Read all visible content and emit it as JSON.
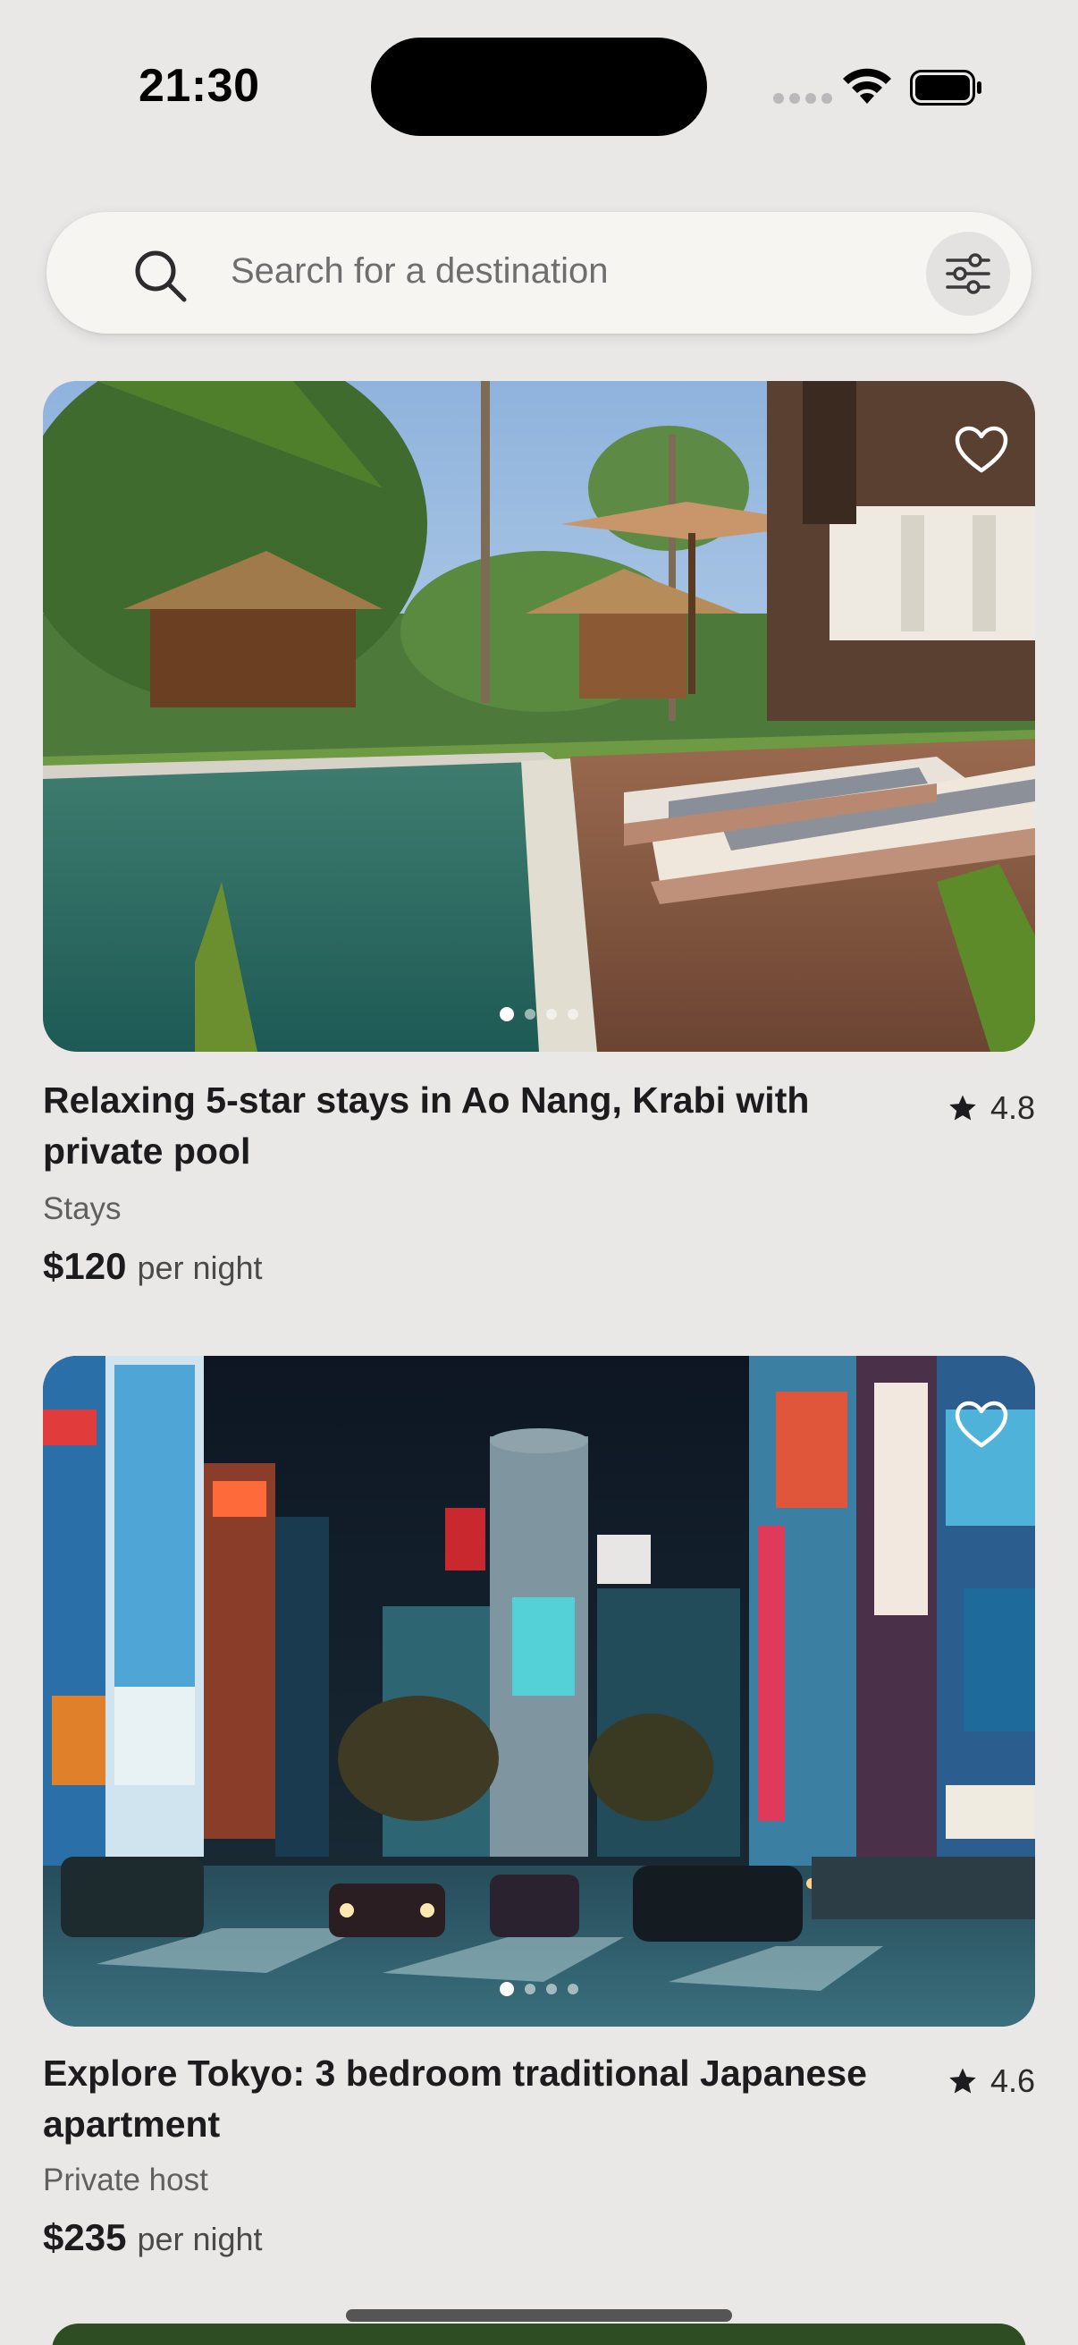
{
  "status_bar": {
    "time": "21:30",
    "icons": [
      "signal-icon",
      "wifi-icon",
      "battery-icon"
    ]
  },
  "search": {
    "placeholder": "Search for a destination",
    "icon": "search-icon",
    "filter_icon": "sliders-icon"
  },
  "listings": [
    {
      "title": "Relaxing 5-star stays in Ao Nang, Krabi with private pool",
      "rating": "4.8",
      "category": "Stays",
      "price": "$120",
      "price_unit": "per night",
      "photo_count": 4,
      "active_photo": 1,
      "favorite_icon": "heart-outline-icon"
    },
    {
      "title": "Explore Tokyo: 3 bedroom traditional Japanese apartment",
      "rating": "4.6",
      "category": "Private host",
      "price": "$235",
      "price_unit": "per night",
      "photo_count": 4,
      "active_photo": 1,
      "favorite_icon": "heart-outline-icon"
    }
  ],
  "colors": {
    "background": "#e9e8e6",
    "search_bg": "#f6f5f2",
    "text": "#1c1c1e"
  }
}
